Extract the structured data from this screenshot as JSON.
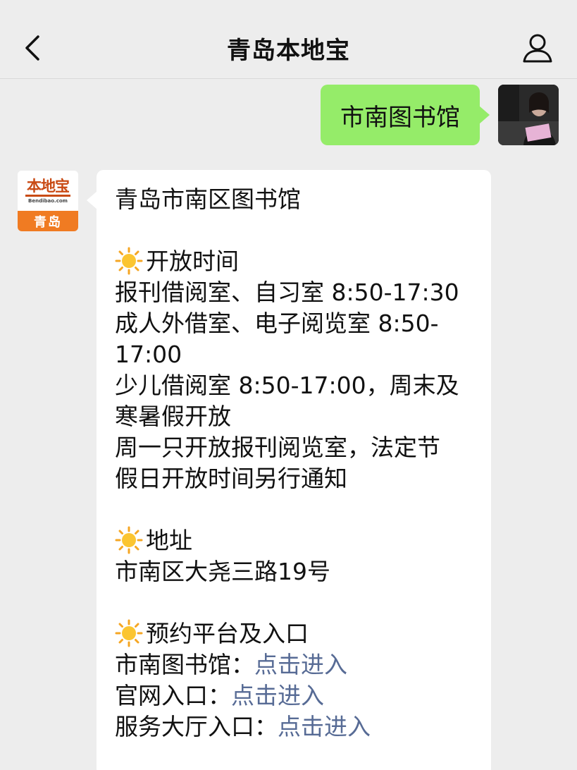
{
  "nav": {
    "title": "青岛本地宝"
  },
  "outgoing": {
    "text": "市南图书馆"
  },
  "sender": {
    "logo_brand": "本地宝",
    "logo_url": "Bendibao.com",
    "logo_city": "青岛"
  },
  "message": {
    "title": "青岛市南区图书馆",
    "hours_heading": "开放时间",
    "hours_lines": [
      "报刊借阅室、自习室 8:50-17:30",
      "成人外借室、电子阅览室 8:50-",
      "17:00",
      "少儿借阅室 8:50-17:00，周末及",
      "寒暑假开放",
      "周一只开放报刊阅览室，法定节",
      "假日开放时间另行通知"
    ],
    "address_heading": "地址",
    "address": "市南区大尧三路19号",
    "booking_heading": "预约平台及入口",
    "booking": [
      {
        "label": "市南图书馆：",
        "link": "点击进入"
      },
      {
        "label": "官网入口：",
        "link": "点击进入"
      },
      {
        "label": "服务大厅入口：",
        "link": "点击进入"
      }
    ]
  },
  "colors": {
    "outgoing_bubble": "#95ec69",
    "link": "#576b95",
    "logo_orange": "#f07b22"
  }
}
